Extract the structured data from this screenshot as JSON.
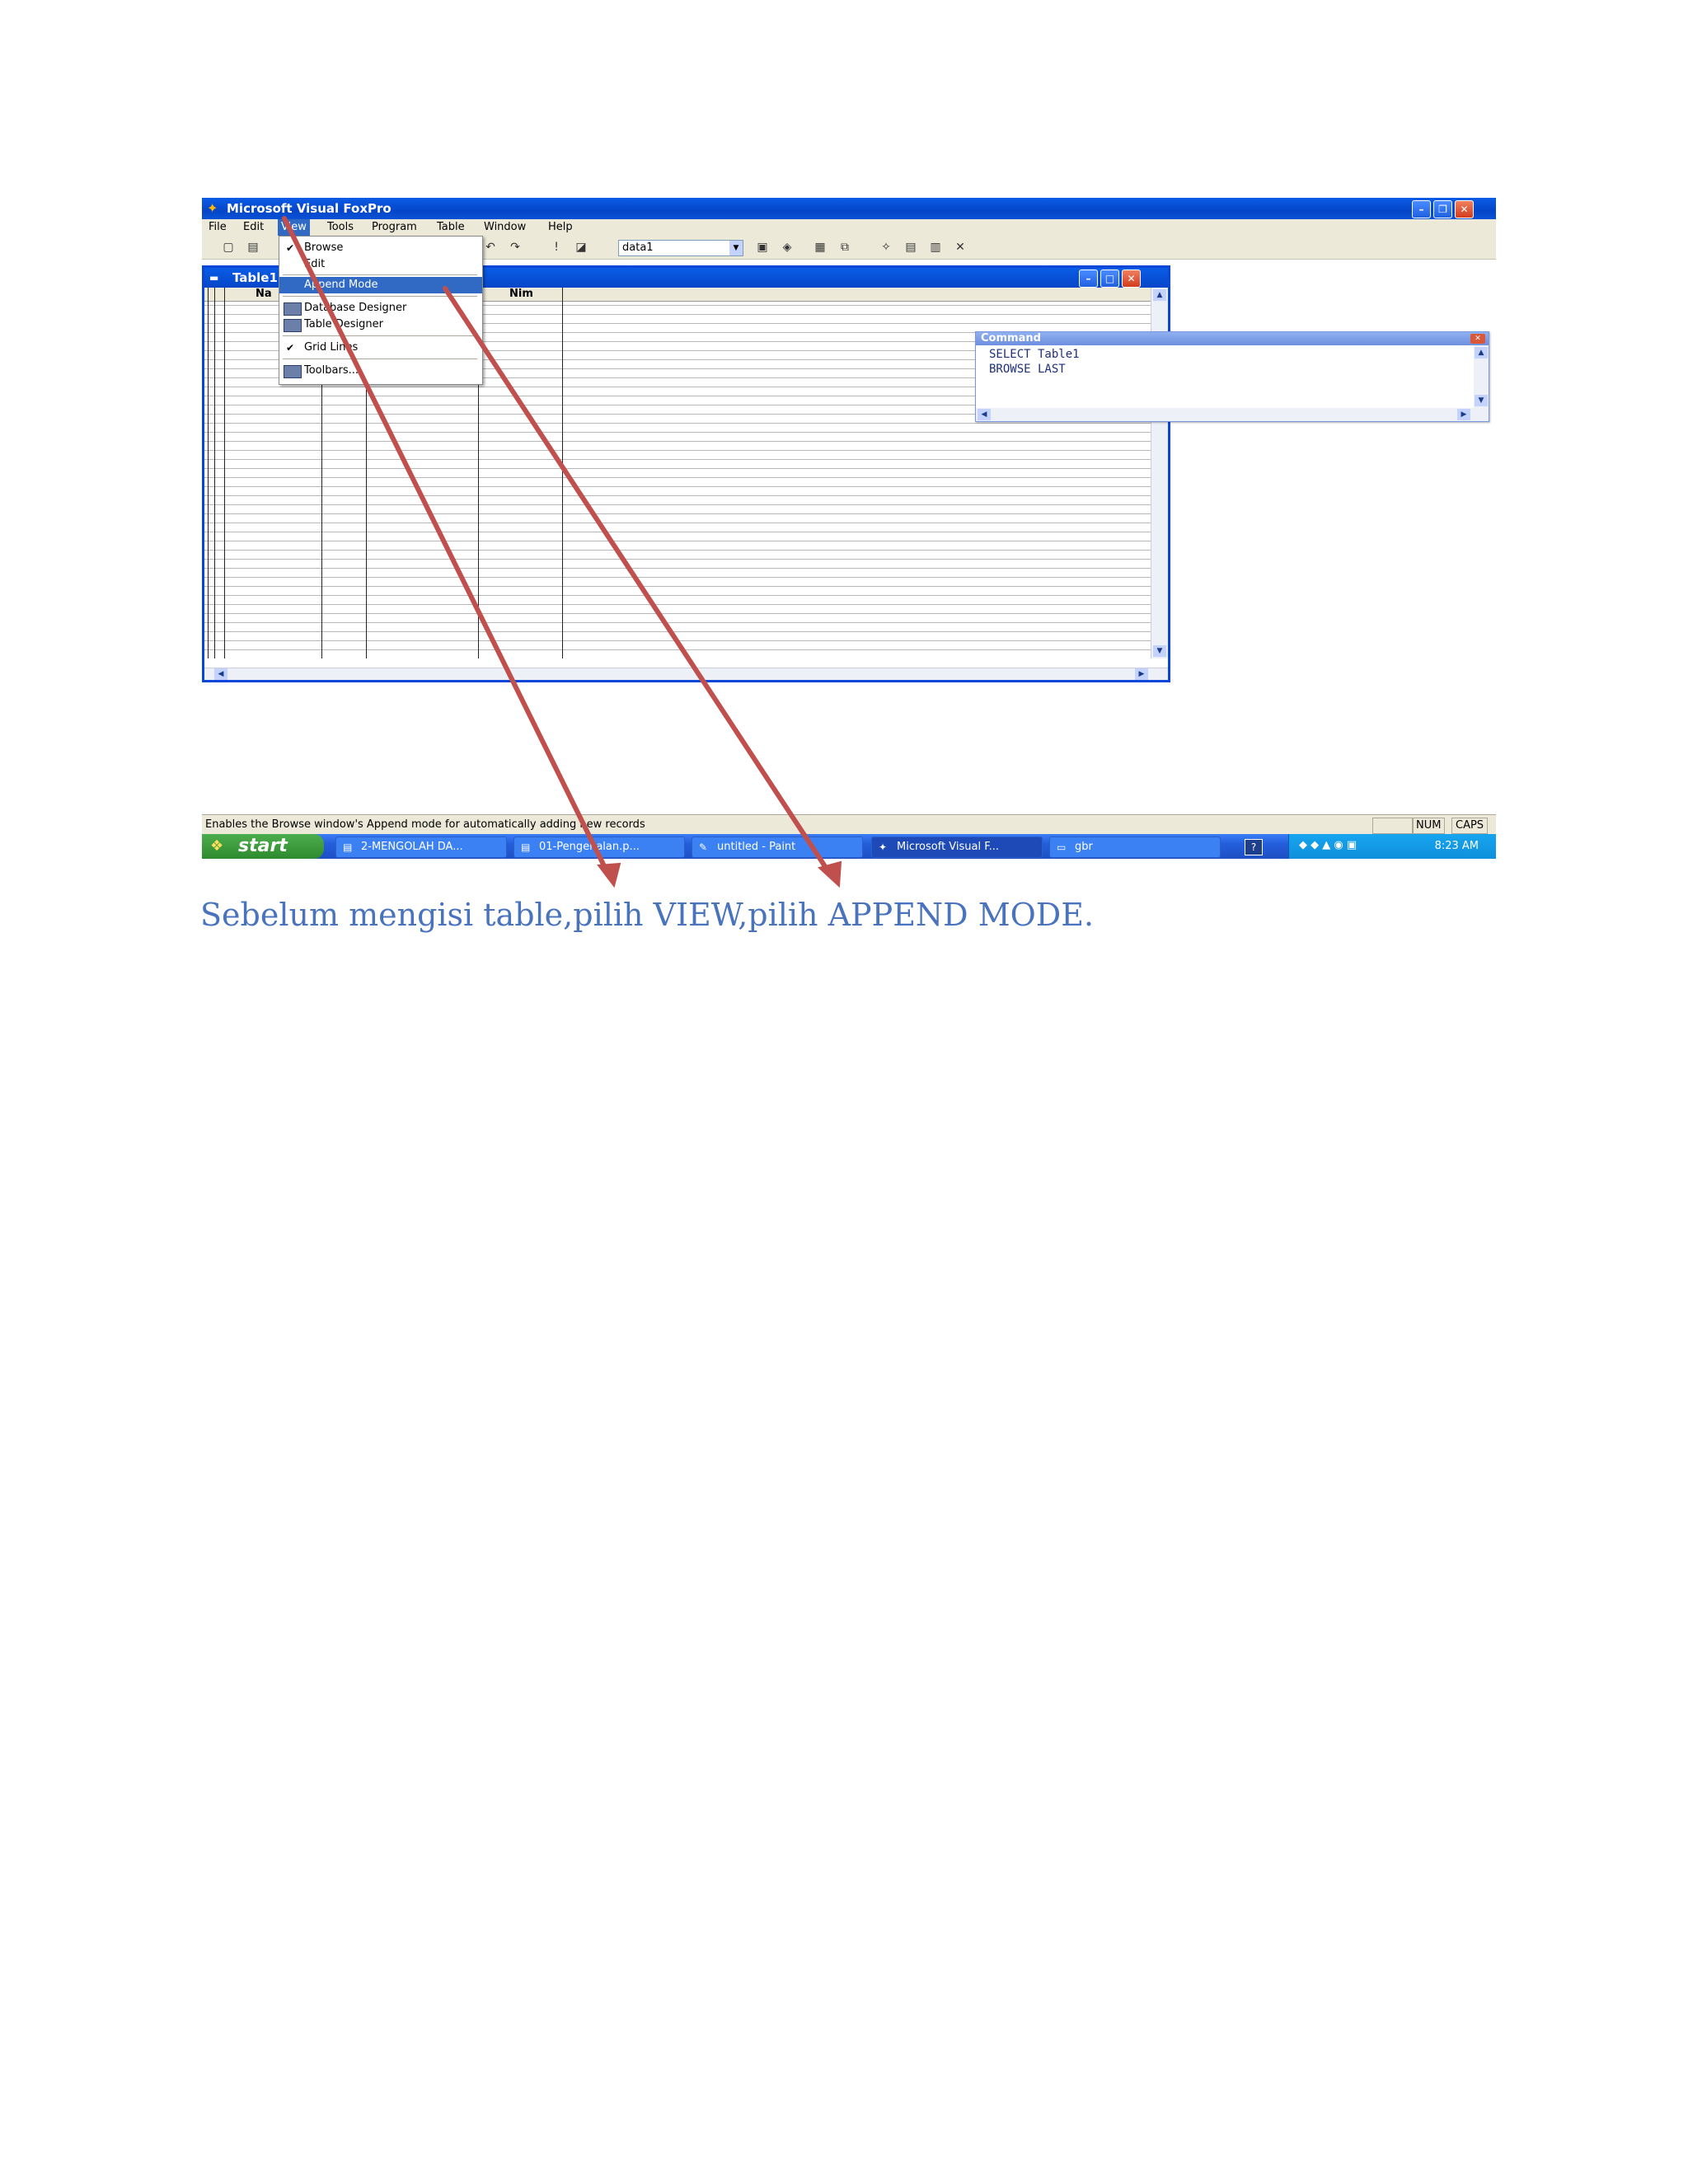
{
  "window": {
    "title": "Microsoft Visual FoxPro",
    "app_icon": "foxpro-icon",
    "controls": [
      "minimize",
      "restore",
      "close"
    ]
  },
  "menubar": {
    "items": [
      "File",
      "Edit",
      "View",
      "Tools",
      "Program",
      "Table",
      "Window",
      "Help"
    ],
    "active": "View"
  },
  "toolbar": {
    "combo_value": "data1"
  },
  "view_menu": {
    "items": [
      {
        "label": "Browse",
        "checked": true
      },
      {
        "label": "Edit"
      },
      {
        "label": "Append Mode",
        "highlighted": true
      },
      {
        "label": "Database Designer"
      },
      {
        "label": "Table Designer"
      },
      {
        "label": "Grid Lines",
        "checked": true
      },
      {
        "label": "Toolbars..."
      }
    ]
  },
  "browse_window": {
    "title": "Table1",
    "columns": [
      "Na",
      "Nim"
    ]
  },
  "command_window": {
    "title": "Command",
    "lines": [
      "SELECT Table1",
      "BROWSE LAST"
    ]
  },
  "statusbar": {
    "text": "Enables the Browse window's Append mode for automatically adding new records",
    "num": "NUM",
    "caps": "CAPS"
  },
  "taskbar": {
    "start": "start",
    "tasks": [
      {
        "label": "2-MENGOLAH DA...",
        "icon": "pdf-icon"
      },
      {
        "label": "01-Pengenalan.p...",
        "icon": "pdf-icon"
      },
      {
        "label": "untitled - Paint",
        "icon": "paint-icon"
      },
      {
        "label": "Microsoft Visual F...",
        "icon": "foxpro-icon",
        "active": true
      },
      {
        "label": "gbr",
        "icon": "folder-icon"
      }
    ],
    "clock": "8:23 AM"
  },
  "annotation": {
    "color": "#c0504d"
  },
  "caption": "Sebelum mengisi table,pilih VIEW,pilih APPEND MODE."
}
